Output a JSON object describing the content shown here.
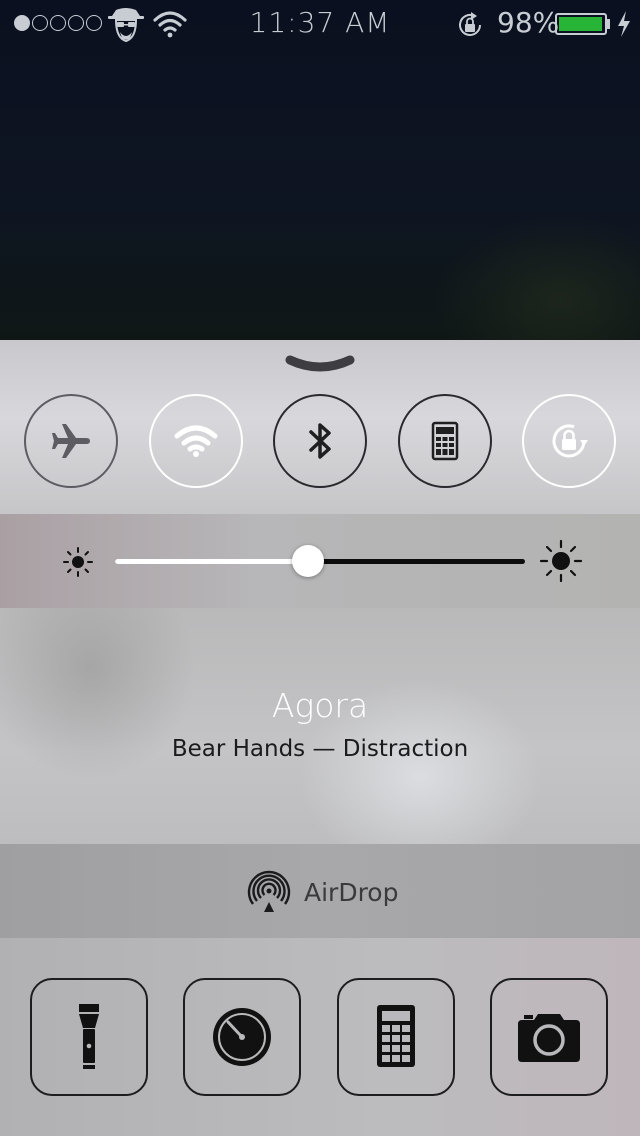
{
  "status_bar": {
    "signal_bars_filled": 1,
    "signal_bars_total": 5,
    "time": "11:37 AM",
    "battery_percent": "98%",
    "battery_level": 0.98,
    "battery_color": "#28b436"
  },
  "control_center": {
    "grabber_icon": "chevron-down",
    "toggles": [
      {
        "name": "airplane-mode",
        "icon": "airplane-icon",
        "state": "off"
      },
      {
        "name": "wifi",
        "icon": "wifi-icon",
        "state": "on"
      },
      {
        "name": "bluetooth",
        "icon": "bluetooth-icon",
        "state": "off"
      },
      {
        "name": "calculator",
        "icon": "calculator-icon",
        "state": "off"
      },
      {
        "name": "rotation-lock",
        "icon": "rotation-lock-icon",
        "state": "on"
      }
    ],
    "brightness": {
      "level": 0.47
    },
    "now_playing": {
      "title": "Agora",
      "subtitle": "Bear Hands — Distraction"
    },
    "airdrop": {
      "label": "AirDrop"
    },
    "quick_launch": [
      {
        "name": "flashlight",
        "icon": "flashlight-icon"
      },
      {
        "name": "timer",
        "icon": "timer-icon"
      },
      {
        "name": "calculator",
        "icon": "calculator-icon"
      },
      {
        "name": "camera",
        "icon": "camera-icon"
      }
    ]
  }
}
